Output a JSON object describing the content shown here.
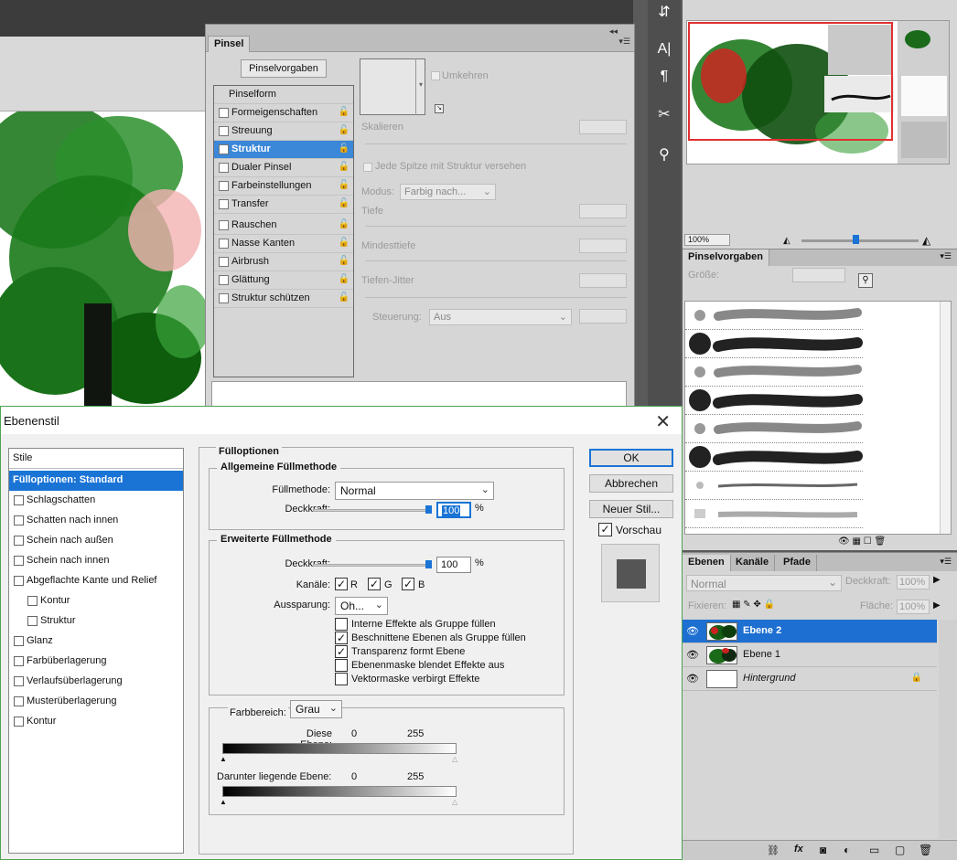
{
  "pinsel_panel": {
    "tab": "Pinsel",
    "vorgaben_button": "Pinselvorgaben",
    "list": [
      {
        "label": "Pinselform",
        "checkbox": false,
        "lock": false,
        "selected": false
      },
      {
        "label": "Formeigenschaften",
        "checkbox": true,
        "lock": true,
        "selected": false
      },
      {
        "label": "Streuung",
        "checkbox": true,
        "lock": true,
        "selected": false
      },
      {
        "label": "Struktur",
        "checkbox": true,
        "lock": true,
        "selected": true
      },
      {
        "label": "Dualer Pinsel",
        "checkbox": true,
        "lock": true,
        "selected": false
      },
      {
        "label": "Farbeinstellungen",
        "checkbox": true,
        "lock": true,
        "selected": false
      },
      {
        "label": "Transfer",
        "checkbox": true,
        "lock": true,
        "selected": false
      },
      {
        "label": "Rauschen",
        "checkbox": true,
        "lock": true,
        "selected": false
      },
      {
        "label": "Nasse Kanten",
        "checkbox": true,
        "lock": true,
        "selected": false
      },
      {
        "label": "Airbrush",
        "checkbox": true,
        "lock": true,
        "selected": false
      },
      {
        "label": "Glättung",
        "checkbox": true,
        "lock": true,
        "selected": false
      },
      {
        "label": "Struktur schützen",
        "checkbox": true,
        "lock": true,
        "selected": false
      }
    ],
    "umkehren": "Umkehren",
    "skalieren": "Skalieren",
    "jede_spitze": "Jede Spitze mit Struktur versehen",
    "modus_label": "Modus:",
    "modus_value": "Farbig nach...",
    "tiefe": "Tiefe",
    "mindesttiefe": "Mindesttiefe",
    "tiefen_jitter": "Tiefen-Jitter",
    "steuerung_label": "Steuerung:",
    "steuerung_value": "Aus"
  },
  "navigator": {
    "zoom": "100%"
  },
  "pinselvorgaben_panel": {
    "tab": "Pinselvorgaben",
    "groesse_label": "Größe:"
  },
  "layers_panel": {
    "tabs": [
      "Ebenen",
      "Kanäle",
      "Pfade"
    ],
    "blend_mode": "Normal",
    "deckkraft_label": "Deckkraft:",
    "deckkraft_value": "100%",
    "fixieren_label": "Fixieren:",
    "flaeche_label": "Fläche:",
    "flaeche_value": "100%",
    "layers": [
      {
        "name": "Ebene 2",
        "selected": true
      },
      {
        "name": "Ebene 1",
        "selected": false
      },
      {
        "name": "Hintergrund",
        "selected": false
      }
    ]
  },
  "dialog": {
    "title": "Ebenenstil",
    "styles_header": "Stile",
    "styles": [
      {
        "label": "Fülloptionen: Standard",
        "selected": true,
        "sub": false,
        "checkbox": false
      },
      {
        "label": "Schlagschatten",
        "selected": false,
        "sub": false,
        "checkbox": true
      },
      {
        "label": "Schatten nach innen",
        "selected": false,
        "sub": false,
        "checkbox": true
      },
      {
        "label": "Schein nach außen",
        "selected": false,
        "sub": false,
        "checkbox": true
      },
      {
        "label": "Schein nach innen",
        "selected": false,
        "sub": false,
        "checkbox": true
      },
      {
        "label": "Abgeflachte Kante und Relief",
        "selected": false,
        "sub": false,
        "checkbox": true
      },
      {
        "label": "Kontur",
        "selected": false,
        "sub": true,
        "checkbox": true
      },
      {
        "label": "Struktur",
        "selected": false,
        "sub": true,
        "checkbox": true
      },
      {
        "label": "Glanz",
        "selected": false,
        "sub": false,
        "checkbox": true
      },
      {
        "label": "Farbüberlagerung",
        "selected": false,
        "sub": false,
        "checkbox": true
      },
      {
        "label": "Verlaufsüberlagerung",
        "selected": false,
        "sub": false,
        "checkbox": true
      },
      {
        "label": "Musterüberlagerung",
        "selected": false,
        "sub": false,
        "checkbox": true
      },
      {
        "label": "Kontur",
        "selected": false,
        "sub": false,
        "checkbox": true
      }
    ],
    "fuelloptionen": "Fülloptionen",
    "allgemeine": "Allgemeine Füllmethode",
    "fuellmethode_label": "Füllmethode:",
    "fuellmethode_value": "Normal",
    "deckkraft_label": "Deckkraft:",
    "deckkraft1_value": "100",
    "deckkraft1_level": 1.0,
    "percent": "%",
    "erweiterte": "Erweiterte Füllmethode",
    "deckkraft2_value": "100",
    "deckkraft2_level": 1.0,
    "kanaele_label": "Kanäle:",
    "channels": [
      {
        "label": "R",
        "checked": true
      },
      {
        "label": "G",
        "checked": true
      },
      {
        "label": "B",
        "checked": true
      }
    ],
    "aussparung_label": "Aussparung:",
    "aussparung_value": "Oh...",
    "options": [
      {
        "label": "Interne Effekte als Gruppe füllen",
        "checked": false
      },
      {
        "label": "Beschnittene Ebenen als Gruppe füllen",
        "checked": true
      },
      {
        "label": "Transparenz formt Ebene",
        "checked": true
      },
      {
        "label": "Ebenenmaske blendet Effekte aus",
        "checked": false
      },
      {
        "label": "Vektormaske verbirgt Effekte",
        "checked": false
      }
    ],
    "farbbereich_label": "Farbbereich:",
    "farbbereich_value": "Grau",
    "diese_ebene_label": "Diese Ebene:",
    "diese_ebene_min": "0",
    "diese_ebene_max": "255",
    "darunter_label": "Darunter liegende Ebene:",
    "darunter_min": "0",
    "darunter_max": "255",
    "ok": "OK",
    "abbrechen": "Abbrechen",
    "neuer_stil": "Neuer Stil...",
    "vorschau": "Vorschau",
    "vorschau_checked": true
  }
}
